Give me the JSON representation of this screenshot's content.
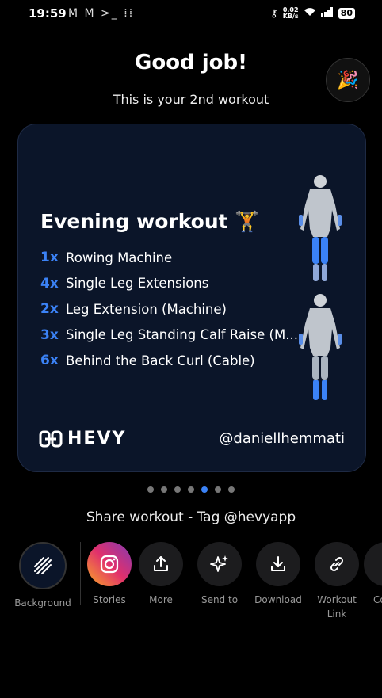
{
  "status": {
    "time": "19:59",
    "left_icons": "M M >_ ⁞⁞",
    "speed_value": "0.02",
    "speed_unit": "KB/s",
    "battery": "80"
  },
  "header": {
    "title": "Good job!",
    "subtitle": "This is your 2nd workout",
    "party_icon": "party-popper-icon"
  },
  "card": {
    "workout_title": "Evening workout 🏋",
    "exercises": [
      {
        "count": "1x",
        "name": "Rowing Machine"
      },
      {
        "count": "4x",
        "name": "Single Leg Extensions"
      },
      {
        "count": "2x",
        "name": "Leg Extension (Machine)"
      },
      {
        "count": "3x",
        "name": "Single Leg Standing Calf Raise (M..."
      },
      {
        "count": "6x",
        "name": "Behind the Back Curl (Cable)"
      }
    ],
    "logo_text": "HEVY",
    "handle": "@daniellhemmati",
    "colors": {
      "accent": "#3b82f6",
      "card_bg": "#0b1529"
    }
  },
  "pager": {
    "count": 7,
    "active": 4
  },
  "share": {
    "title": "Share workout - Tag @hevyapp",
    "actions": [
      {
        "label": "Background",
        "icon": "diagonal-lines-icon"
      },
      {
        "label": "Stories",
        "icon": "instagram-icon"
      },
      {
        "label": "More",
        "icon": "share-upload-icon"
      },
      {
        "label": "Send to",
        "icon": "sparkles-icon"
      },
      {
        "label": "Download",
        "icon": "download-icon"
      },
      {
        "label": "Workout Link",
        "icon": "link-icon"
      },
      {
        "label": "Co",
        "icon": "copy-icon"
      }
    ]
  }
}
